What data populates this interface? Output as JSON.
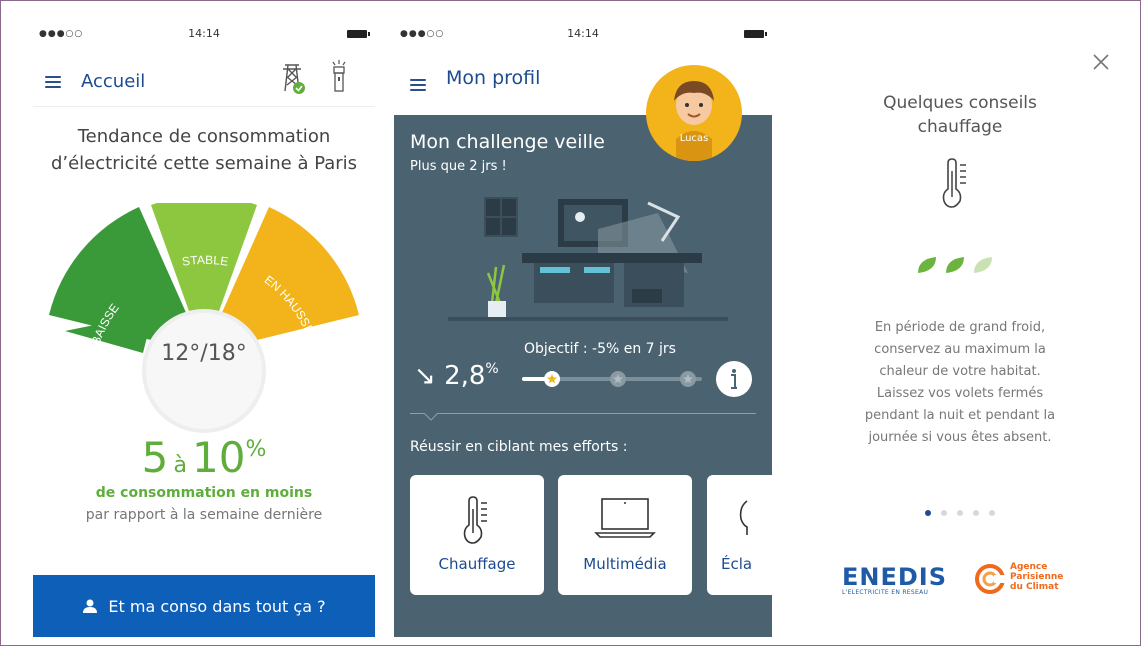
{
  "screen1": {
    "status": {
      "time": "14:14"
    },
    "title": "Accueil",
    "heading_line1": "Tendance de consommation",
    "heading_line2": "d’électricité cette semaine à Paris",
    "gauge": {
      "low": "EN BAISSE",
      "mid": "STABLE",
      "high": "EN HAUSSE",
      "selected": "EN BAISSE"
    },
    "range": "12°/18°",
    "pct": {
      "from": "5",
      "sep": "à",
      "to": "10",
      "unit": "%"
    },
    "sub1": "de consommation en moins",
    "sub2": "par rapport à la semaine dernière",
    "cta": "Et ma conso dans tout ça ?"
  },
  "screen2": {
    "status": {
      "time": "14:14"
    },
    "title": "Mon profil",
    "avatar_name": "Lucas",
    "challenge_title": "Mon challenge veille",
    "challenge_sub": "Plus que 2 jrs !",
    "objective": "Objectif : -5% en 7 jrs",
    "value": "2,8",
    "value_unit": "%",
    "progress": 0.2,
    "reussir": "Réussir en ciblant mes efforts :",
    "cards": [
      "Chauffage",
      "Multimédia",
      "Écla"
    ]
  },
  "screen3": {
    "heading_line1": "Quelques conseils",
    "heading_line2": "chauffage",
    "leaves": {
      "filled": 2,
      "total": 3
    },
    "text": [
      "En période de grand froid,",
      "conservez au maximum la",
      "chaleur de votre habitat.",
      "Laissez vos volets fermés",
      "pendant la nuit et pendant la",
      "journée si vous  êtes absent."
    ],
    "pagination": {
      "active": 1,
      "total": 5
    },
    "enedis": {
      "logo": "ENEDIS",
      "tagline": "L'ELECTRICITE EN RESEAU"
    },
    "apc": {
      "line1": "Agence",
      "line2": "Parisienne",
      "line3": "du Climat"
    }
  },
  "colors": {
    "blue": "#1d4b8f",
    "green": "#5fae3b",
    "orange": "#f2b41a",
    "panel": "#4b6371",
    "cta": "#0e5fb8"
  }
}
